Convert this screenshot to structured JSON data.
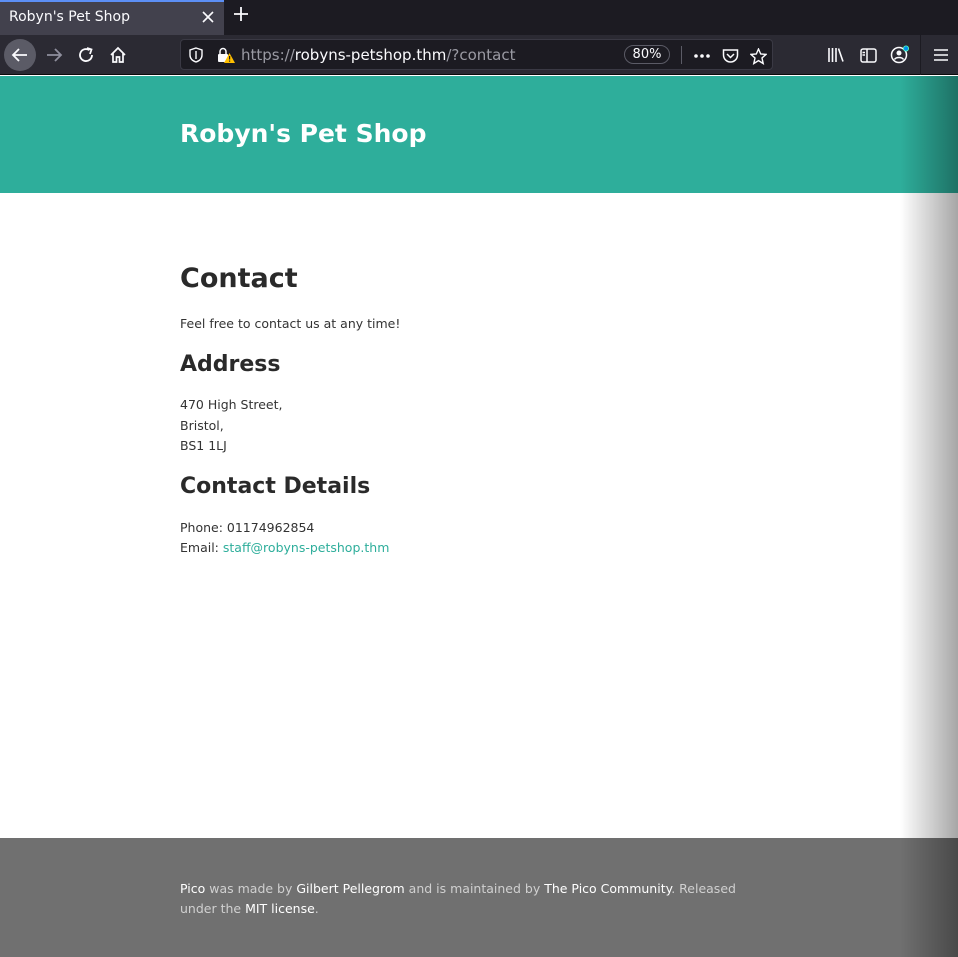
{
  "browser": {
    "tab_title": "Robyn's Pet Shop",
    "url_scheme": "https://",
    "url_host": "robyns-petshop.thm",
    "url_path": "/?contact",
    "zoom": "80%"
  },
  "header": {
    "site_title": "Robyn's Pet Shop"
  },
  "main": {
    "heading": "Contact",
    "intro": "Feel free to contact us at any time!",
    "address_heading": "Address",
    "address_lines": [
      "470 High Street,",
      "Bristol,",
      "BS1 1LJ"
    ],
    "details_heading": "Contact Details",
    "phone_label": "Phone: ",
    "phone": "01174962854",
    "email_label": "Email: ",
    "email": "staff@robyns-petshop.thm"
  },
  "footer": {
    "pico": "Pico",
    "made_by": " was made by ",
    "author": "Gilbert Pellegrom",
    "maintained": " and is maintained by ",
    "community": "The Pico Community",
    "released": ". Released under the ",
    "license": "MIT license",
    "end": "."
  },
  "colors": {
    "accent": "#2eae9b",
    "footer_bg": "#707070",
    "chrome_bg": "#2b2a33"
  }
}
